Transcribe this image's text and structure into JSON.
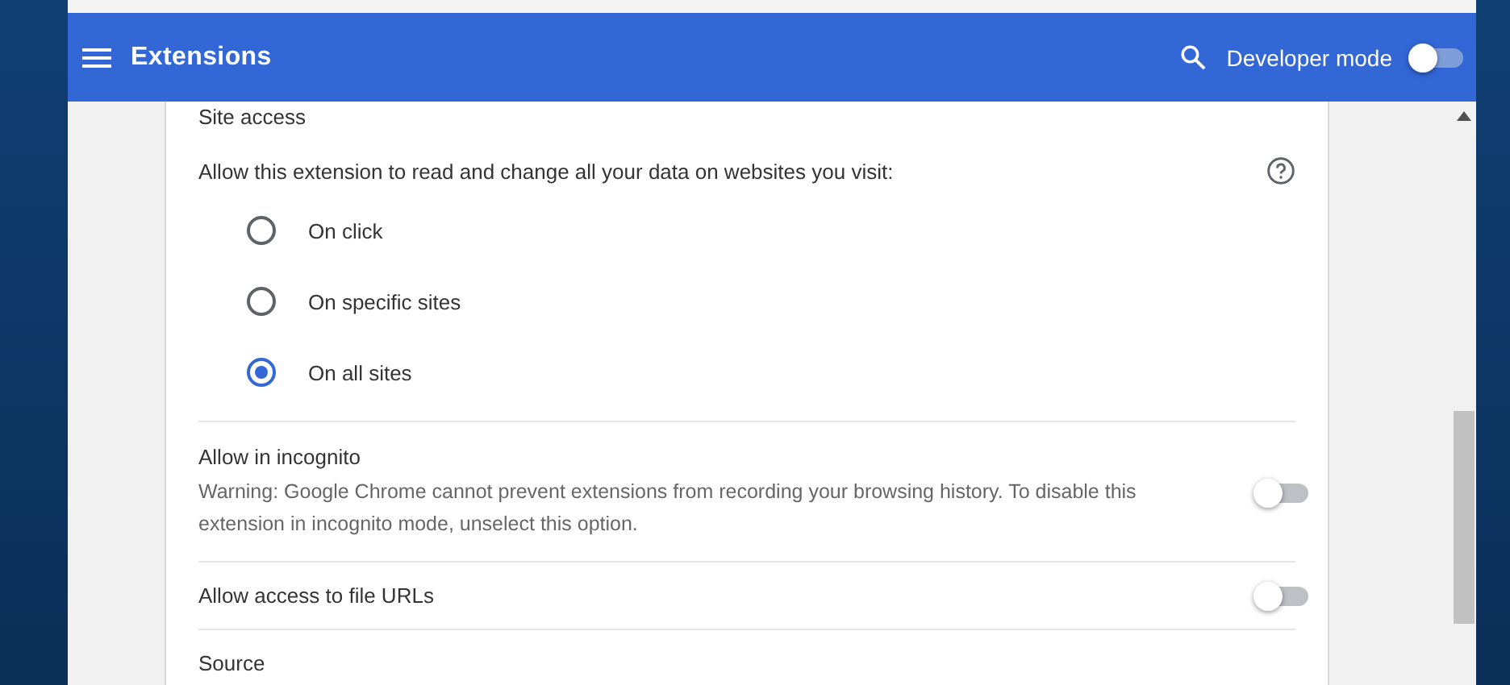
{
  "header": {
    "title": "Extensions",
    "developer_mode": {
      "label": "Developer mode",
      "on": false
    }
  },
  "site_access": {
    "heading": "Site access",
    "prompt": "Allow this extension to read and change all your data on websites you visit:",
    "options": [
      {
        "label": "On click",
        "selected": false
      },
      {
        "label": "On specific sites",
        "selected": false
      },
      {
        "label": "On all sites",
        "selected": true
      }
    ]
  },
  "settings": [
    {
      "title": "Allow in incognito",
      "description": "Warning: Google Chrome cannot prevent extensions from recording your browsing history. To disable this extension in incognito mode, unselect this option.",
      "on": false
    },
    {
      "title": "Allow access to file URLs",
      "on": false
    }
  ],
  "source": {
    "heading": "Source"
  }
}
